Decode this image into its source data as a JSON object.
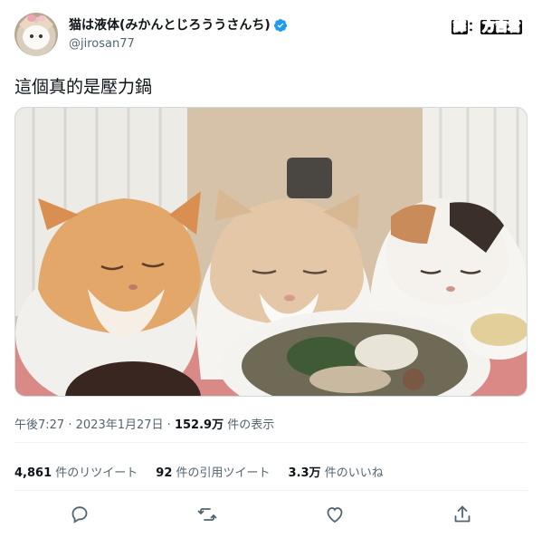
{
  "author": {
    "display_name": "猫は液体(みかんとじろううさんち)",
    "handle": "@jirosan77",
    "verified": true
  },
  "translator_badge": {
    "char1": "譯",
    "sep": "：",
    "name": "方吉君"
  },
  "tweet": {
    "text": "這個真的是壓力鍋"
  },
  "meta": {
    "time": "午後7:27",
    "sep": "·",
    "date": "2023年1月27日",
    "views_count": "152.9万",
    "views_label": "件の表示"
  },
  "stats": [
    {
      "count": "4,861",
      "label": "件のリツイート"
    },
    {
      "count": "92",
      "label": "件の引用ツイート"
    },
    {
      "count": "3.3万",
      "label": "件のいいね"
    }
  ],
  "actions": [
    "reply-icon",
    "retweet-icon",
    "like-icon",
    "share-icon"
  ],
  "colors": {
    "text": "#0f1419",
    "secondary": "#536471",
    "verified": "#1d9bf0",
    "divider": "#eff3f4"
  }
}
